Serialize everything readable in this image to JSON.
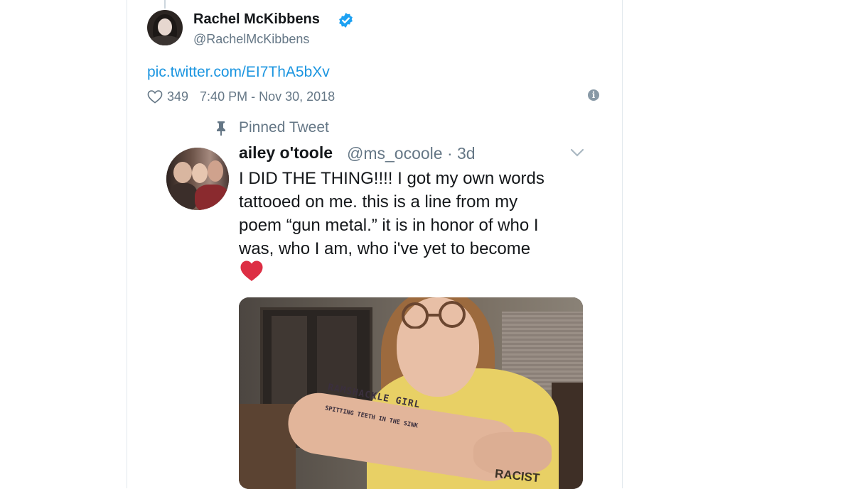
{
  "tweet": {
    "display_name": "Rachel McKibbens",
    "handle": "@RachelMcKibbens",
    "link_text": "pic.twitter.com/EI7ThA5bXv",
    "likes": "349",
    "timestamp": "7:40 PM - Nov 30, 2018",
    "verified_color": "#1da1f2",
    "link_color": "#1b95e0"
  },
  "embedded": {
    "pinned_label": "Pinned Tweet",
    "name": "ailey o'toole",
    "handle_time": "@ms_ocoole · 3d",
    "text_lines": [
      "I DID THE THING!!!! I got my own words",
      "tattooed on me. this is a line from my",
      "poem “gun metal.” it is in honor of who I",
      "was, who I am, who i've yet to become"
    ],
    "emoji": "red-heart",
    "photo": {
      "tattoo_line1": "RAMSHACKLE GIRL",
      "tattoo_line2": "SPITTING TEETH IN THE SINK",
      "shirt_text": "RACIST"
    }
  },
  "icons": [
    "heart-icon",
    "info-icon",
    "verified-icon",
    "pin-icon",
    "chevron-down-icon"
  ]
}
